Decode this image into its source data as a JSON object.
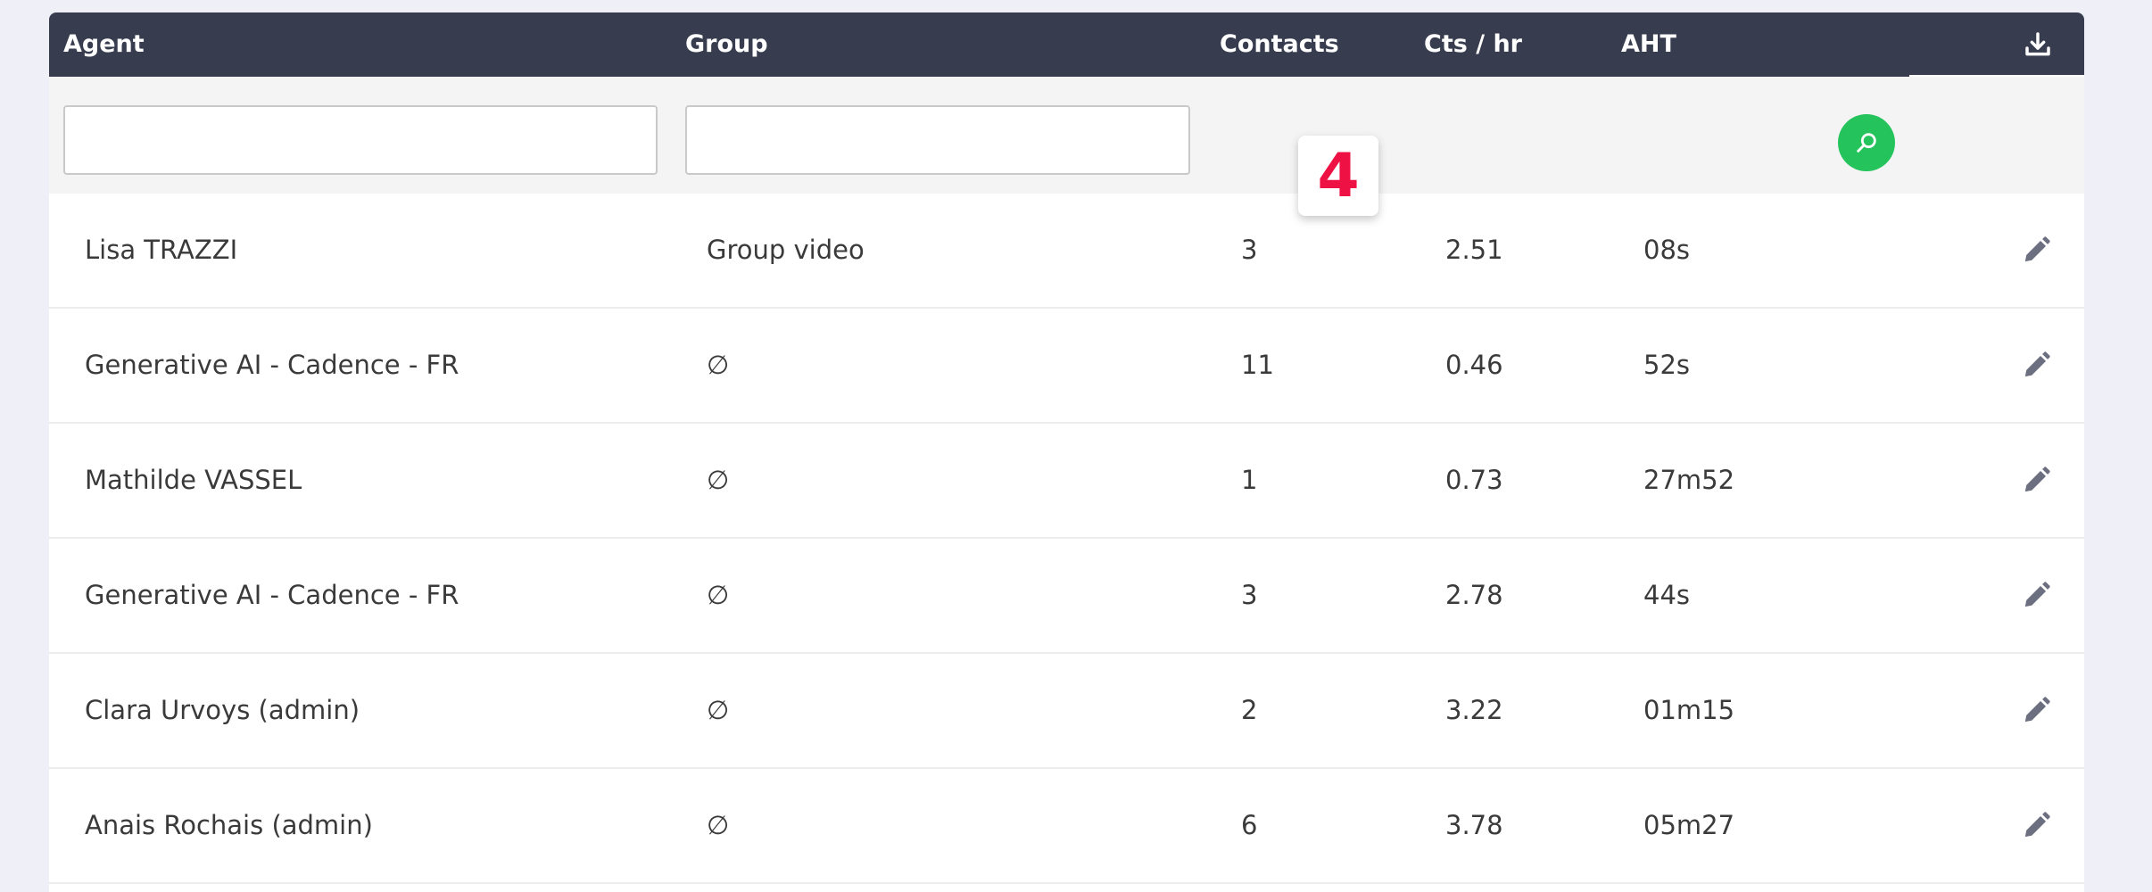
{
  "table": {
    "columns": {
      "agent": "Agent",
      "group": "Group",
      "contacts": "Contacts",
      "cts_hr": "Cts / hr",
      "aht": "AHT"
    },
    "filters": {
      "agent_value": "",
      "group_value": ""
    },
    "rows": [
      {
        "agent": "Lisa TRAZZI",
        "group": "Group video",
        "contacts": "3",
        "cts_hr": "2.51",
        "aht": "08s"
      },
      {
        "agent": "Generative AI - Cadence - FR",
        "group": "∅",
        "contacts": "11",
        "cts_hr": "0.46",
        "aht": "52s"
      },
      {
        "agent": "Mathilde VASSEL",
        "group": "∅",
        "contacts": "1",
        "cts_hr": "0.73",
        "aht": "27m52"
      },
      {
        "agent": "Generative AI - Cadence - FR",
        "group": "∅",
        "contacts": "3",
        "cts_hr": "2.78",
        "aht": "44s"
      },
      {
        "agent": "Clara Urvoys (admin)",
        "group": "∅",
        "contacts": "2",
        "cts_hr": "3.22",
        "aht": "01m15"
      },
      {
        "agent": "Anais Rochais (admin)",
        "group": "∅",
        "contacts": "6",
        "cts_hr": "3.78",
        "aht": "05m27"
      }
    ]
  },
  "badge": {
    "value": "4"
  },
  "icons": {
    "download": "download-icon",
    "search": "search-icon",
    "edit": "pencil-icon"
  },
  "colors": {
    "header_bg": "#373d4f",
    "accent_green": "#24c35c",
    "badge_red": "#ee1144",
    "icon_gray": "#6b6f80"
  }
}
